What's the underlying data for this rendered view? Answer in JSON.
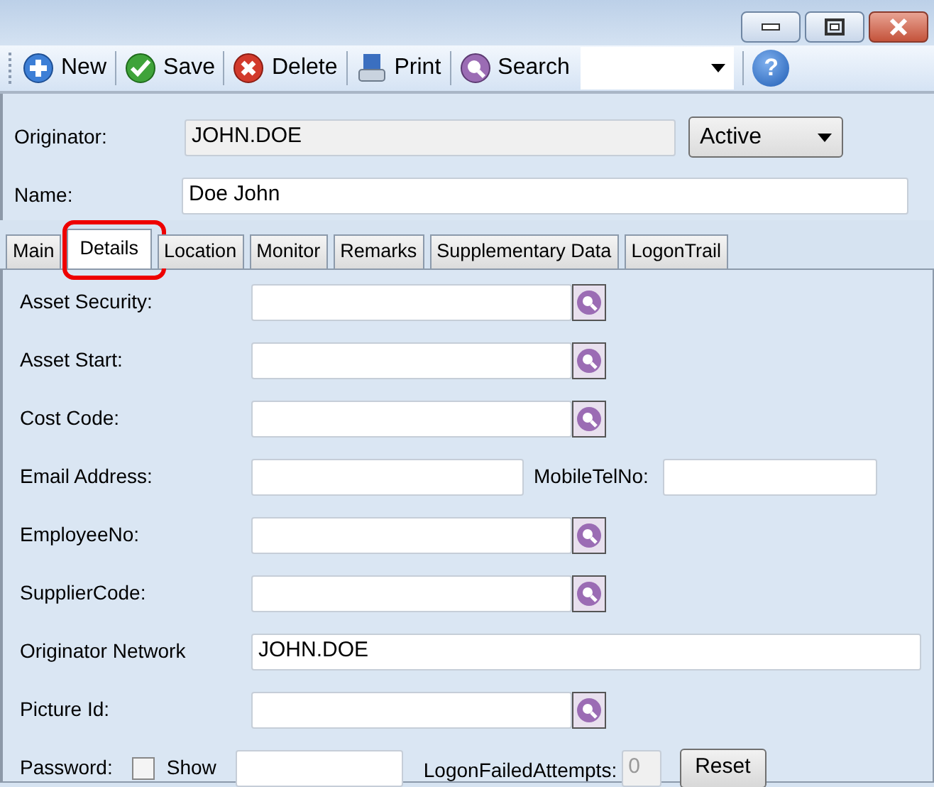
{
  "toolbar": {
    "buttons": [
      {
        "label": "New",
        "kind": "new"
      },
      {
        "label": "Save",
        "kind": "save"
      },
      {
        "label": "Delete",
        "kind": "delete"
      },
      {
        "label": "Print",
        "kind": "print"
      },
      {
        "label": "Search",
        "kind": "search"
      }
    ],
    "help": "?"
  },
  "header": {
    "originator": {
      "label": "Originator:",
      "value": "JOHN.DOE"
    },
    "status": "Active",
    "name": {
      "label": "Name:",
      "value": "Doe John"
    }
  },
  "tabs": [
    {
      "label": "Main",
      "selected": false,
      "highlighted": false
    },
    {
      "label": "Details",
      "selected": true,
      "highlighted": true
    },
    {
      "label": "Location",
      "selected": false,
      "highlighted": false
    },
    {
      "label": "Monitor",
      "selected": false,
      "highlighted": false
    },
    {
      "label": "Remarks",
      "selected": false,
      "highlighted": false
    },
    {
      "label": "Supplementary Data",
      "selected": false,
      "highlighted": false
    },
    {
      "label": "LogonTrail",
      "selected": false,
      "highlighted": false
    }
  ],
  "fields": [
    {
      "kind": "lookup",
      "label": "Asset Security:"
    },
    {
      "kind": "lookup",
      "label": "Asset Start:"
    },
    {
      "kind": "lookup",
      "label": "Cost Code:"
    },
    {
      "kind": "pair",
      "label": "Email Address:",
      "label2": "MobileTelNo:"
    },
    {
      "kind": "lookup",
      "label": "EmployeeNo:"
    },
    {
      "kind": "lookup",
      "label": "SupplierCode:"
    },
    {
      "kind": "text",
      "label": "Originator Network",
      "value": "JOHN.DOE"
    },
    {
      "kind": "lookup",
      "label": "Picture Id:"
    },
    {
      "kind": "password",
      "label": "Password:",
      "show_label": "Show",
      "show_checked": false,
      "attempts_label": "LogonFailedAttempts:",
      "attempts": "0",
      "reset": "Reset"
    }
  ]
}
